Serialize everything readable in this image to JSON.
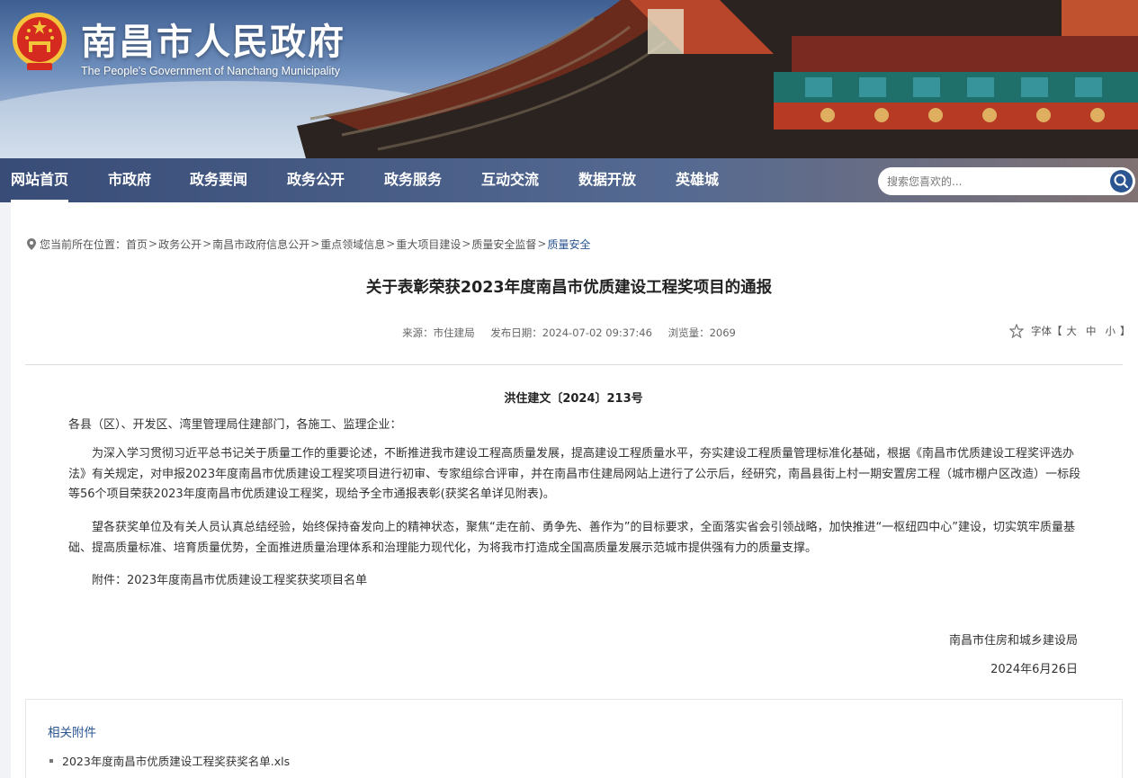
{
  "header": {
    "title": "南昌市人民政府",
    "subtitle": "The People's Government of Nanchang Municipality"
  },
  "nav": {
    "items": [
      {
        "label": "网站首页",
        "active": true
      },
      {
        "label": "市政府"
      },
      {
        "label": "政务要闻"
      },
      {
        "label": "政务公开"
      },
      {
        "label": "政务服务"
      },
      {
        "label": "互动交流"
      },
      {
        "label": "数据开放"
      },
      {
        "label": "英雄城"
      }
    ],
    "search_placeholder": "搜索您喜欢的..."
  },
  "breadcrumb": {
    "prefix": "您当前所在位置：",
    "items": [
      "首页",
      "政务公开",
      "南昌市政府信息公开",
      "重点领域信息",
      "重大项目建设",
      "质量安全监督",
      "质量安全"
    ]
  },
  "article": {
    "title": "关于表彰荣获2023年度南昌市优质建设工程奖项目的通报",
    "source": "来源：市住建局",
    "date": "发布日期：2024-07-02 09:37:46",
    "views": "浏览量：2069",
    "font_label": "字体【",
    "font_large": "大",
    "font_medium": "中",
    "font_small": "小",
    "font_end": "】",
    "doc_number": "洪住建文〔2024〕213号",
    "salutation": "各县（区）、开发区、湾里管理局住建部门，各施工、监理企业：",
    "paragraph_1": "为深入学习贯彻习近平总书记关于质量工作的重要论述，不断推进我市建设工程高质量发展，提高建设工程质量水平，夯实建设工程质量管理标准化基础，根据《南昌市优质建设工程奖评选办法》有关规定，对申报2023年度南昌市优质建设工程奖项目进行初审、专家组综合评审，并在南昌市住建局网站上进行了公示后，经研究，南昌县街上村一期安置房工程（城市棚户区改造）一标段等56个项目荣获2023年度南昌市优质建设工程奖，现给予全市通报表彰(获奖名单详见附表)。",
    "paragraph_2": "望各获奖单位及有关人员认真总结经验，始终保持奋发向上的精神状态，聚焦“走在前、勇争先、善作为”的目标要求，全面落实省会引领战略，加快推进“一枢纽四中心”建设，切实筑牢质量基础、提高质量标准、培育质量优势，全面推进质量治理体系和治理能力现代化，为将我市打造成全国高质量发展示范城市提供强有力的质量支撑。",
    "paragraph_3": "附件：2023年度南昌市优质建设工程奖获奖项目名单",
    "signature_org": "南昌市住房和城乡建设局",
    "signature_date": "2024年6月26日"
  },
  "attachments": {
    "title": "相关附件",
    "items": [
      "2023年度南昌市优质建设工程奖获奖名单.xls"
    ]
  },
  "colors": {
    "nav_bg": "#2f4a7d",
    "accent_blue": "#2a5591",
    "emblem_red": "#d42a20",
    "emblem_gold": "#f3c53a"
  }
}
